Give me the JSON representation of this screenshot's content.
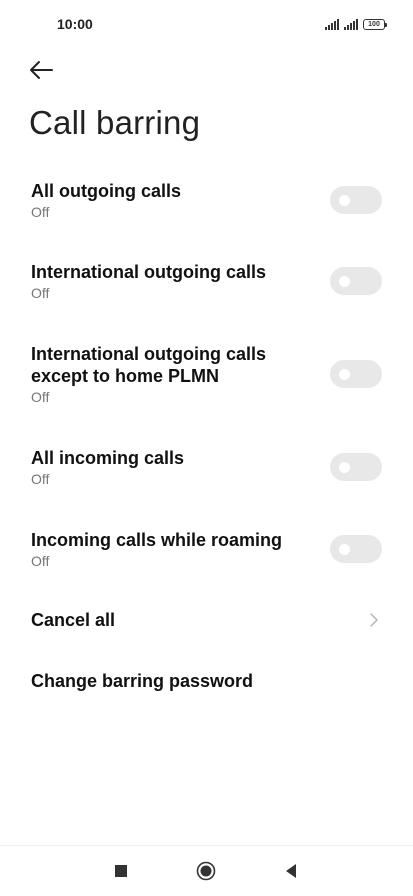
{
  "status_bar": {
    "time": "10:00",
    "battery": "100"
  },
  "header": {
    "back_icon": "arrow-left-icon",
    "title": "Call barring"
  },
  "settings": [
    {
      "title": "All outgoing calls",
      "subtitle": "Off",
      "control": "toggle",
      "enabled": false
    },
    {
      "title": "International outgoing calls",
      "subtitle": "Off",
      "control": "toggle",
      "enabled": false
    },
    {
      "title": "International outgoing calls except to home PLMN",
      "subtitle": "Off",
      "control": "toggle",
      "enabled": false
    },
    {
      "title": "All incoming calls",
      "subtitle": "Off",
      "control": "toggle",
      "enabled": false
    },
    {
      "title": "Incoming calls while roaming",
      "subtitle": "Off",
      "control": "toggle",
      "enabled": false
    },
    {
      "title": "Cancel all",
      "control": "chevron"
    },
    {
      "title": "Change barring password",
      "control": "none"
    }
  ],
  "nav_bar": {
    "recents_icon": "square-icon",
    "home_icon": "circle-icon",
    "back_icon": "triangle-back-icon"
  },
  "colors": {
    "toggle_track_off": "#e8e8e8",
    "subtitle": "#777777",
    "text": "#111111"
  }
}
